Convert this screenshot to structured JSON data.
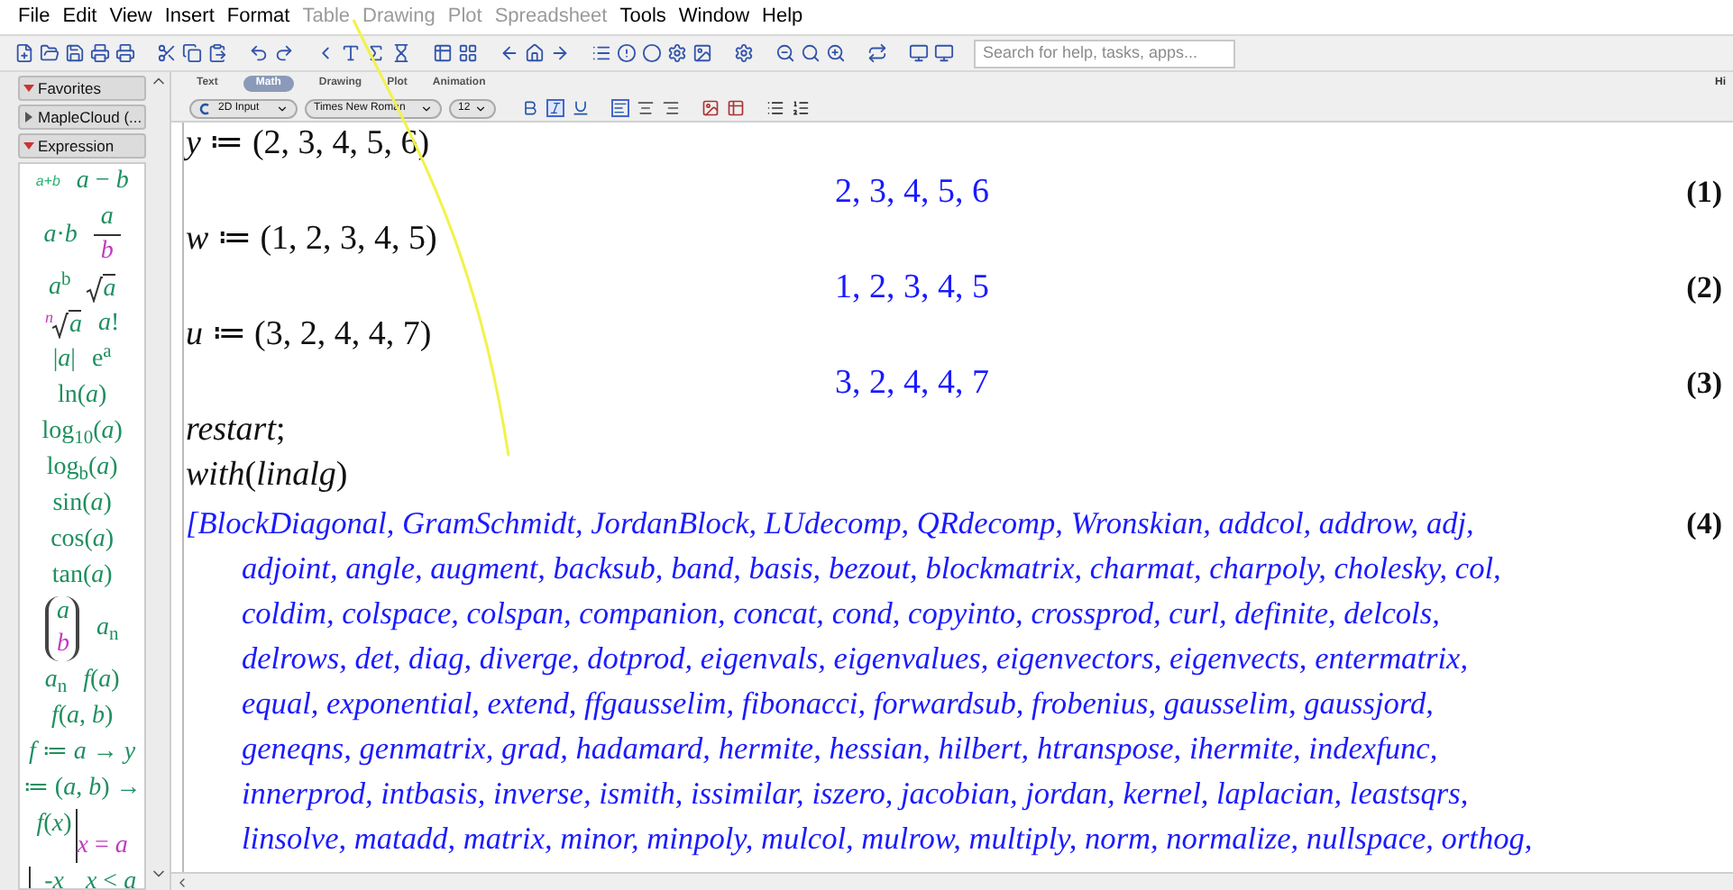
{
  "menu": [
    {
      "label": "File",
      "disabled": false
    },
    {
      "label": "Edit",
      "disabled": false
    },
    {
      "label": "View",
      "disabled": false
    },
    {
      "label": "Insert",
      "disabled": false
    },
    {
      "label": "Format",
      "disabled": false
    },
    {
      "label": "Table",
      "disabled": true
    },
    {
      "label": "Drawing",
      "disabled": true
    },
    {
      "label": "Plot",
      "disabled": true
    },
    {
      "label": "Spreadsheet",
      "disabled": true
    },
    {
      "label": "Tools",
      "disabled": false
    },
    {
      "label": "Window",
      "disabled": false
    },
    {
      "label": "Help",
      "disabled": false
    }
  ],
  "search": {
    "placeholder": "Search for help, tasks, apps..."
  },
  "palettes": [
    {
      "label": "Favorites",
      "expanded": true
    },
    {
      "label": "MapleCloud (...",
      "expanded": false
    },
    {
      "label": "Expression",
      "expanded": true
    }
  ],
  "palette_rows": [
    [
      {
        "kind": "small",
        "text": "a+b"
      },
      {
        "kind": "text",
        "text": "*a* − *b*"
      }
    ],
    [
      {
        "kind": "text",
        "text": "*a*·*b*"
      },
      {
        "kind": "fraction",
        "num": "a",
        "den": "b"
      }
    ],
    [
      {
        "kind": "text",
        "text": "*a*$^{b}$"
      },
      {
        "kind": "sqrt",
        "text": "a"
      }
    ],
    [
      {
        "kind": "root",
        "index": "n",
        "text": "a"
      },
      {
        "kind": "text",
        "text": "*a*!"
      }
    ],
    [
      {
        "kind": "text",
        "text": "|*a*|"
      },
      {
        "kind": "text",
        "text": "e$^{a}$"
      }
    ],
    [
      {
        "kind": "text",
        "text": "ln(*a*)"
      }
    ],
    [
      {
        "kind": "text",
        "text": "log$_{10}$(*a*)"
      }
    ],
    [
      {
        "kind": "text",
        "text": "log$_{b}$(*a*)"
      }
    ],
    [
      {
        "kind": "text",
        "text": "sin(*a*)"
      }
    ],
    [
      {
        "kind": "text",
        "text": "cos(*a*)"
      }
    ],
    [
      {
        "kind": "text",
        "text": "tan(*a*)"
      }
    ],
    [
      {
        "kind": "column",
        "num": "a",
        "den": "b"
      },
      {
        "kind": "text",
        "text": "*a*$_{n}$"
      }
    ],
    [
      {
        "kind": "text",
        "text": "*a*$_{n}$"
      },
      {
        "kind": "text",
        "text": "*f*(*a*)"
      }
    ],
    [
      {
        "kind": "text",
        "text": "*f*(*a*, *b*)"
      }
    ],
    [
      {
        "kind": "text",
        "text": "*f* ≔ *a* → *y*"
      }
    ],
    [
      {
        "kind": "text",
        "text": "≔ (*a*, *b*) →"
      }
    ],
    [
      {
        "kind": "eval",
        "expr": "*f*(*x*)",
        "at": "*x* = *a*"
      }
    ],
    [
      {
        "kind": "piecewise",
        "expr": "-*x*",
        "cond": "*x* < *a*"
      }
    ]
  ],
  "context_tabs": [
    {
      "label": "Text",
      "selected": false
    },
    {
      "label": "Math",
      "selected": true
    },
    {
      "label": "Drawing",
      "selected": false
    },
    {
      "label": "Plot",
      "selected": false
    },
    {
      "label": "Animation",
      "selected": false
    }
  ],
  "context_right": "Hi",
  "format": {
    "mode": "2D Input",
    "font": "Times New Roman",
    "size": "12",
    "bold": false,
    "italic": true,
    "underline": false
  },
  "document": [
    {
      "kind": "input",
      "text": "*y* ≔ (2, 3, 4, 5, 6)"
    },
    {
      "kind": "output",
      "text": "2, 3, 4, 5, 6",
      "label": "(1)"
    },
    {
      "kind": "input",
      "text": "*w* ≔ (1, 2, 3, 4, 5)"
    },
    {
      "kind": "output",
      "text": "1, 2, 3, 4, 5",
      "label": "(2)"
    },
    {
      "kind": "input",
      "text": "*u* ≔ (3, 2, 4, 4, 7)"
    },
    {
      "kind": "output",
      "text": "3, 2, 4, 4, 7",
      "label": "(3)"
    },
    {
      "kind": "input",
      "text": "*restart*;"
    },
    {
      "kind": "input",
      "text": "*with*(*linalg*)"
    },
    {
      "kind": "list",
      "label": "(4)",
      "lines": [
        "[BlockDiagonal, GramSchmidt, JordanBlock, LUdecomp, QRdecomp, Wronskian, addcol, addrow, adj,",
        "adjoint, angle, augment, backsub, band, basis, bezout, blockmatrix, charmat, charpoly, cholesky, col,",
        "coldim, colspace, colspan, companion, concat, cond, copyinto, crossprod, curl, definite, delcols,",
        "delrows, det, diag, diverge, dotprod, eigenvals, eigenvalues, eigenvectors, eigenvects, entermatrix,",
        "equal, exponential, extend, ffgausselim, fibonacci, forwardsub, frobenius, gausselim, gaussjord,",
        "geneqns, genmatrix, grad, hadamard, hermite, hessian, hilbert, htranspose, ihermite, indexfunc,",
        "innerprod, intbasis, inverse, ismith, issimilar, iszero, jacobian, jordan, kernel, laplacian, leastsqrs,",
        "linsolve, matadd, matrix, minor, minpoly, mulcol, mulrow, multiply, norm, normalize, nullspace, orthog,"
      ]
    }
  ]
}
